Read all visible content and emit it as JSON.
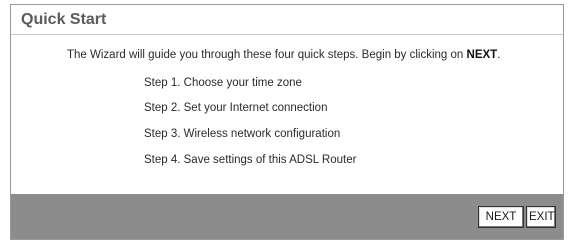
{
  "panel": {
    "title": "Quick Start",
    "intro_text": "The Wizard will guide you through these four quick steps. Begin by clicking on ",
    "intro_bold": "NEXT",
    "intro_end": "."
  },
  "steps": [
    "Step 1. Choose your time zone",
    "Step 2. Set your Internet connection",
    "Step 3. Wireless network configuration",
    "Step 4. Save settings of this ADSL Router"
  ],
  "buttons": {
    "next_label": "NEXT",
    "exit_label": "EXIT"
  },
  "colors": {
    "footer": "#8c8c8c",
    "title": "#5c5c5c"
  }
}
